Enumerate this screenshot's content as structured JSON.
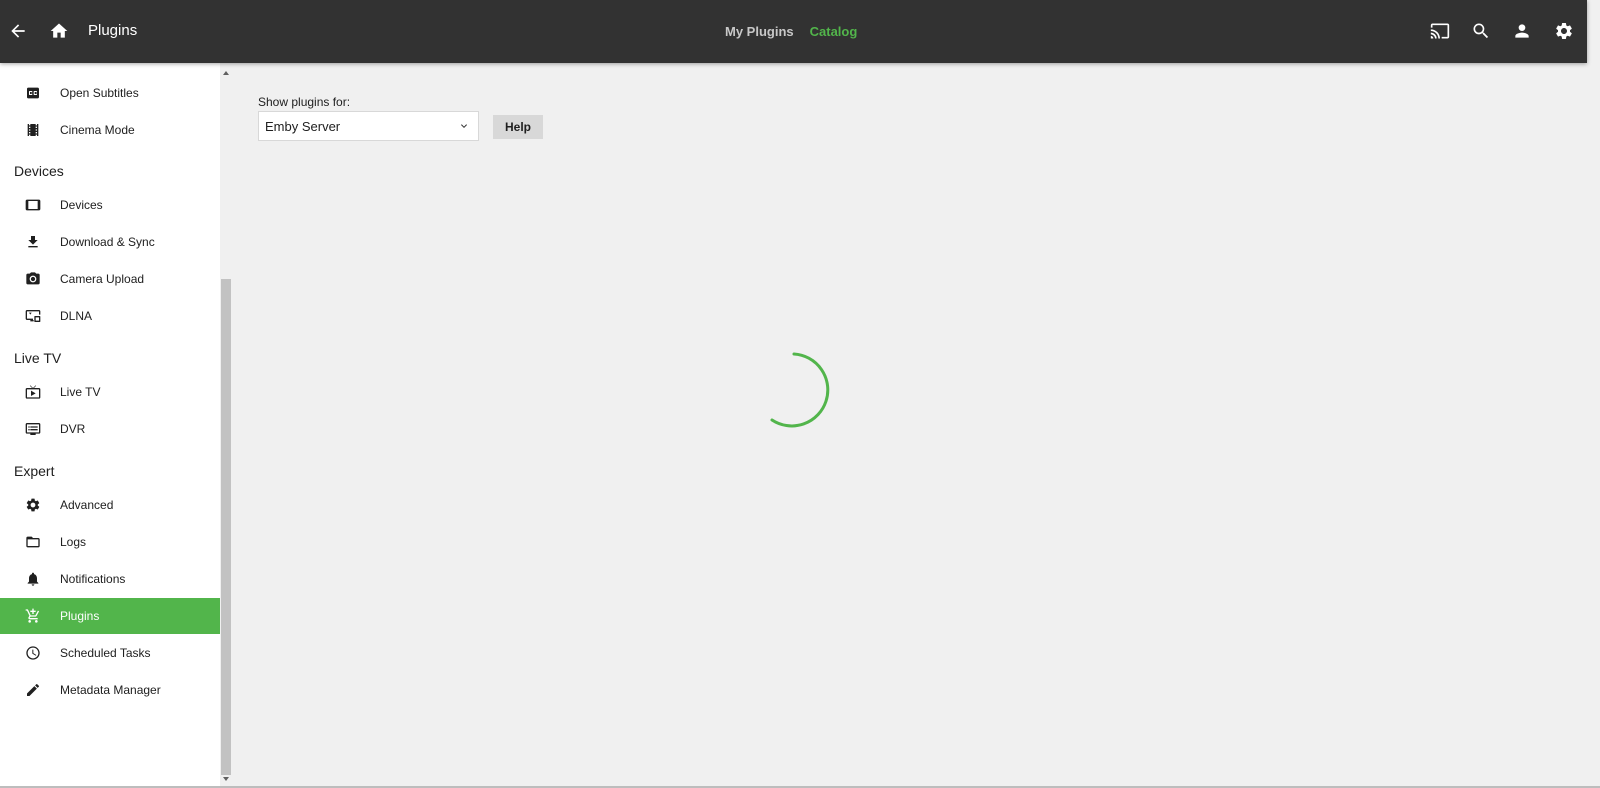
{
  "header": {
    "title": "Plugins",
    "tabs": [
      {
        "label": "My Plugins",
        "active": false
      },
      {
        "label": "Catalog",
        "active": true
      }
    ],
    "icons": [
      "back-arrow-icon",
      "home-icon",
      "cast-icon",
      "search-icon",
      "user-icon",
      "gear-icon"
    ]
  },
  "sidebar": {
    "sections": {
      "devices": "Devices",
      "live_tv": "Live TV",
      "expert": "Expert"
    },
    "items": {
      "open_subtitles": "Open Subtitles",
      "cinema_mode": "Cinema Mode",
      "devices": "Devices",
      "download_sync": "Download & Sync",
      "camera_upload": "Camera Upload",
      "dlna": "DLNA",
      "live_tv": "Live TV",
      "dvr": "DVR",
      "advanced": "Advanced",
      "logs": "Logs",
      "notifications": "Notifications",
      "plugins": "Plugins",
      "scheduled_tasks": "Scheduled Tasks",
      "metadata_manager": "Metadata Manager"
    },
    "active_item": "plugins"
  },
  "content": {
    "filter_label": "Show plugins for:",
    "filter_value": "Emby Server",
    "help_label": "Help",
    "loading": true
  },
  "colors": {
    "accent": "#52b54b",
    "header_bg": "#323232",
    "page_bg": "#f0f0f0"
  }
}
